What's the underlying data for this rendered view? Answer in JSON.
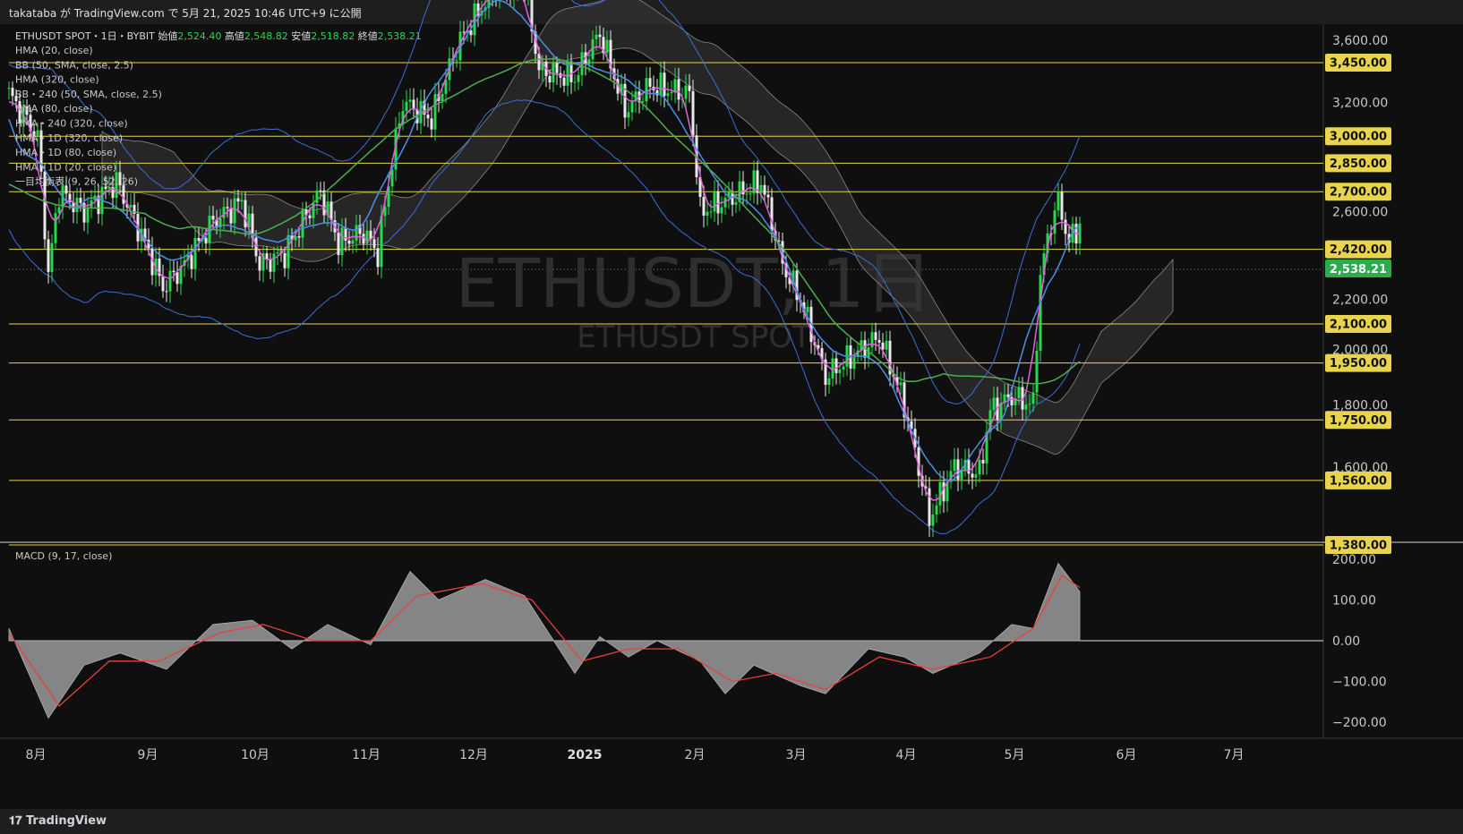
{
  "header": {
    "title": "takataba が TradingView.com で 5月 21, 2025 10:46 UTC+9 に公開"
  },
  "footer": {
    "brand": "TradingView"
  },
  "colors": {
    "up": "#26d94a",
    "down": "#e8e8e8",
    "hma20": "#e060e0",
    "hma80": "#4a90e8",
    "hma320": "#4caf50",
    "bb": "#3b6fd4",
    "level": "#e8d44d",
    "macd_line": "#e84040",
    "macd_hist": "#9a9a9a",
    "price_tag": "#2eaa4f"
  },
  "legend": {
    "symbol": "ETHUSDT SPOT・1日・BYBIT",
    "ohlc": [
      {
        "label": "始値",
        "value": "2,524.40"
      },
      {
        "label": "高値",
        "value": "2,548.82"
      },
      {
        "label": "安値",
        "value": "2,518.82"
      },
      {
        "label": "終値",
        "value": "2,538.21"
      }
    ],
    "indicators": [
      "HMA (20, close)",
      "BB (50, SMA, close, 2.5)",
      "HMA (320, close)",
      "BB・240 (50, SMA, close, 2.5)",
      "HMA (80, close)",
      "HMA・240 (320, close)",
      "HMA・1D (320, close)",
      "HMA・1D (80, close)",
      "HMA・1D (20, close)",
      "一目均衡表 (9, 26, 52, 26)"
    ]
  },
  "watermark": {
    "big": "ETHUSDT, 1日",
    "small": "ETHUSDT SPOT"
  },
  "macd_label": "MACD (9, 17, close)",
  "chart_data": [
    {
      "type": "candlestick",
      "symbol": "ETHUSDT",
      "price_axis_ticks": [
        {
          "value": 3600,
          "label": "3,600.00"
        },
        {
          "value": 3200,
          "label": "3,200.00"
        },
        {
          "value": 2600,
          "label": "2,600.00"
        },
        {
          "value": 2200,
          "label": "2,200.00"
        },
        {
          "value": 2000,
          "label": "2,000.00"
        },
        {
          "value": 1800,
          "label": "1,800.00"
        },
        {
          "value": 1600,
          "label": "1,600.00"
        }
      ],
      "horizontal_levels": [
        3450,
        3000,
        2850,
        2700,
        2420,
        2100,
        1950,
        1750,
        1560,
        1380
      ],
      "level_labels": [
        "3,450.00",
        "3,000.00",
        "2,850.00",
        "2,700.00",
        "2,420.00",
        "2,100.00",
        "1,950.00",
        "1,750.00",
        "1,560.00",
        "1,380.00"
      ],
      "last_price": 2538.21,
      "last_price_label": "2,538.21",
      "y_scale": "log",
      "time_axis": {
        "labels": [
          "8月",
          "9月",
          "10月",
          "11月",
          "12月",
          "2025",
          "2月",
          "3月",
          "4月",
          "5月",
          "6月",
          "7月"
        ],
        "bold": [
          "2025"
        ]
      },
      "close_path": [
        [
          "2024-07-25",
          3250
        ],
        [
          "2024-08-02",
          3000
        ],
        [
          "2024-08-05",
          2300
        ],
        [
          "2024-08-08",
          2700
        ],
        [
          "2024-08-15",
          2600
        ],
        [
          "2024-08-24",
          2750
        ],
        [
          "2024-09-01",
          2450
        ],
        [
          "2024-09-06",
          2250
        ],
        [
          "2024-09-12",
          2350
        ],
        [
          "2024-09-20",
          2550
        ],
        [
          "2024-09-28",
          2650
        ],
        [
          "2024-10-03",
          2350
        ],
        [
          "2024-10-10",
          2400
        ],
        [
          "2024-10-20",
          2700
        ],
        [
          "2024-10-25",
          2450
        ],
        [
          "2024-11-01",
          2500
        ],
        [
          "2024-11-05",
          2400
        ],
        [
          "2024-11-12",
          3200
        ],
        [
          "2024-11-20",
          3100
        ],
        [
          "2024-11-28",
          3600
        ],
        [
          "2024-12-07",
          3950
        ],
        [
          "2024-12-16",
          3990
        ],
        [
          "2024-12-20",
          3400
        ],
        [
          "2024-12-30",
          3350
        ],
        [
          "2025-01-06",
          3650
        ],
        [
          "2025-01-13",
          3150
        ],
        [
          "2025-01-20",
          3300
        ],
        [
          "2025-01-31",
          3250
        ],
        [
          "2025-02-03",
          2600
        ],
        [
          "2025-02-10",
          2650
        ],
        [
          "2025-02-20",
          2750
        ],
        [
          "2025-02-26",
          2350
        ],
        [
          "2025-03-03",
          2200
        ],
        [
          "2025-03-10",
          1900
        ],
        [
          "2025-03-20",
          2000
        ],
        [
          "2025-03-25",
          2050
        ],
        [
          "2025-04-01",
          1800
        ],
        [
          "2025-04-08",
          1450
        ],
        [
          "2025-04-15",
          1600
        ],
        [
          "2025-04-22",
          1580
        ],
        [
          "2025-04-25",
          1780
        ],
        [
          "2025-05-01",
          1830
        ],
        [
          "2025-05-07",
          1800
        ],
        [
          "2025-05-09",
          2300
        ],
        [
          "2025-05-12",
          2550
        ],
        [
          "2025-05-14",
          2650
        ],
        [
          "2025-05-17",
          2450
        ],
        [
          "2025-05-20",
          2538
        ]
      ],
      "series": [
        {
          "name": "HMA (20, close)"
        },
        {
          "name": "HMA (80, close)"
        },
        {
          "name": "HMA (320, close)"
        },
        {
          "name": "BB (50, SMA, close, 2.5)"
        },
        {
          "name": "一目均衡表 (9, 26, 52, 26)"
        }
      ]
    },
    {
      "type": "area",
      "name": "MACD (9, 17, close)",
      "y_axis_ticks": [
        {
          "value": 200,
          "label": "200.00"
        },
        {
          "value": 100,
          "label": "100.00"
        },
        {
          "value": 0,
          "label": "0.00"
        },
        {
          "value": -100,
          "label": "−100.00"
        },
        {
          "value": -200,
          "label": "−200.00"
        }
      ],
      "ylim": [
        -230,
        230
      ],
      "macd": [
        [
          "2024-07-25",
          30
        ],
        [
          "2024-08-05",
          -190
        ],
        [
          "2024-08-15",
          -60
        ],
        [
          "2024-08-25",
          -30
        ],
        [
          "2024-09-07",
          -70
        ],
        [
          "2024-09-20",
          40
        ],
        [
          "2024-10-01",
          50
        ],
        [
          "2024-10-12",
          -20
        ],
        [
          "2024-10-22",
          40
        ],
        [
          "2024-11-03",
          -10
        ],
        [
          "2024-11-14",
          170
        ],
        [
          "2024-11-22",
          100
        ],
        [
          "2024-12-05",
          150
        ],
        [
          "2024-12-16",
          110
        ],
        [
          "2024-12-30",
          -80
        ],
        [
          "2025-01-06",
          10
        ],
        [
          "2025-01-14",
          -40
        ],
        [
          "2025-01-22",
          0
        ],
        [
          "2025-02-03",
          -50
        ],
        [
          "2025-02-10",
          -130
        ],
        [
          "2025-02-18",
          -60
        ],
        [
          "2025-03-03",
          -110
        ],
        [
          "2025-03-10",
          -130
        ],
        [
          "2025-03-22",
          -20
        ],
        [
          "2025-04-01",
          -40
        ],
        [
          "2025-04-09",
          -80
        ],
        [
          "2025-04-22",
          -30
        ],
        [
          "2025-05-01",
          40
        ],
        [
          "2025-05-07",
          30
        ],
        [
          "2025-05-14",
          190
        ],
        [
          "2025-05-20",
          120
        ]
      ],
      "signal": [
        [
          "2024-07-25",
          20
        ],
        [
          "2024-08-08",
          -160
        ],
        [
          "2024-08-22",
          -50
        ],
        [
          "2024-09-05",
          -50
        ],
        [
          "2024-09-22",
          20
        ],
        [
          "2024-10-04",
          40
        ],
        [
          "2024-10-18",
          0
        ],
        [
          "2024-11-03",
          0
        ],
        [
          "2024-11-16",
          110
        ],
        [
          "2024-12-04",
          140
        ],
        [
          "2024-12-18",
          100
        ],
        [
          "2025-01-01",
          -50
        ],
        [
          "2025-01-14",
          -20
        ],
        [
          "2025-01-28",
          -20
        ],
        [
          "2025-02-12",
          -100
        ],
        [
          "2025-02-24",
          -80
        ],
        [
          "2025-03-10",
          -120
        ],
        [
          "2025-03-25",
          -40
        ],
        [
          "2025-04-09",
          -70
        ],
        [
          "2025-04-25",
          -40
        ],
        [
          "2025-05-07",
          30
        ],
        [
          "2025-05-15",
          160
        ],
        [
          "2025-05-20",
          130
        ]
      ]
    }
  ]
}
